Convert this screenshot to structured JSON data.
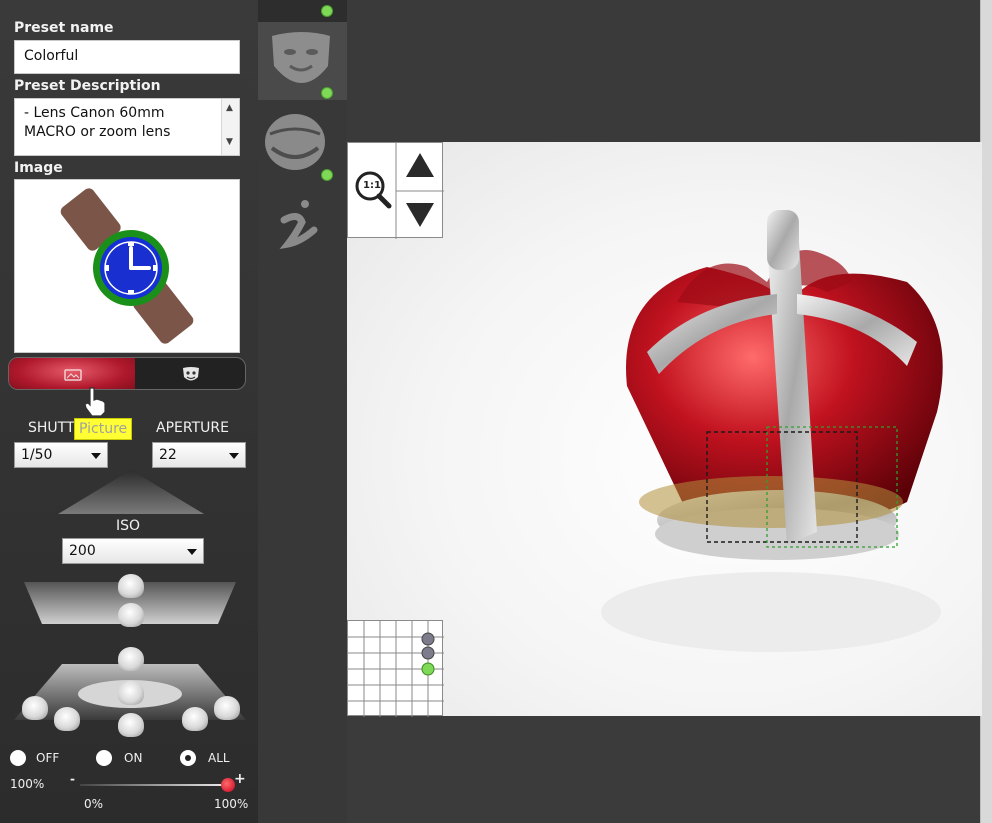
{
  "preset": {
    "name_label": "Preset name",
    "name_value": "Colorful",
    "description_label": "Preset Description",
    "description_value": "- Lens Canon 60mm MACRO or zoom lens",
    "image_label": "Image"
  },
  "mode": {
    "tooltip": "Picture",
    "shutter_label": "SHUTT",
    "aperture_label": "APERTURE",
    "shutter_value": "1/50",
    "aperture_value": "22",
    "iso_label": "ISO",
    "iso_value": "200"
  },
  "light_mode": {
    "off_label": "OFF",
    "on_label": "ON",
    "all_label": "ALL",
    "selected": "ALL"
  },
  "intensity": {
    "left_label": "100%",
    "minus": "-",
    "plus": "+",
    "min_label": "0%",
    "max_label": "100%",
    "value_fraction": 1.0
  },
  "viewer": {
    "zoom_text": "1:1"
  },
  "colors": {
    "accent_red": "#b0182c",
    "status_green": "#7ed957"
  }
}
